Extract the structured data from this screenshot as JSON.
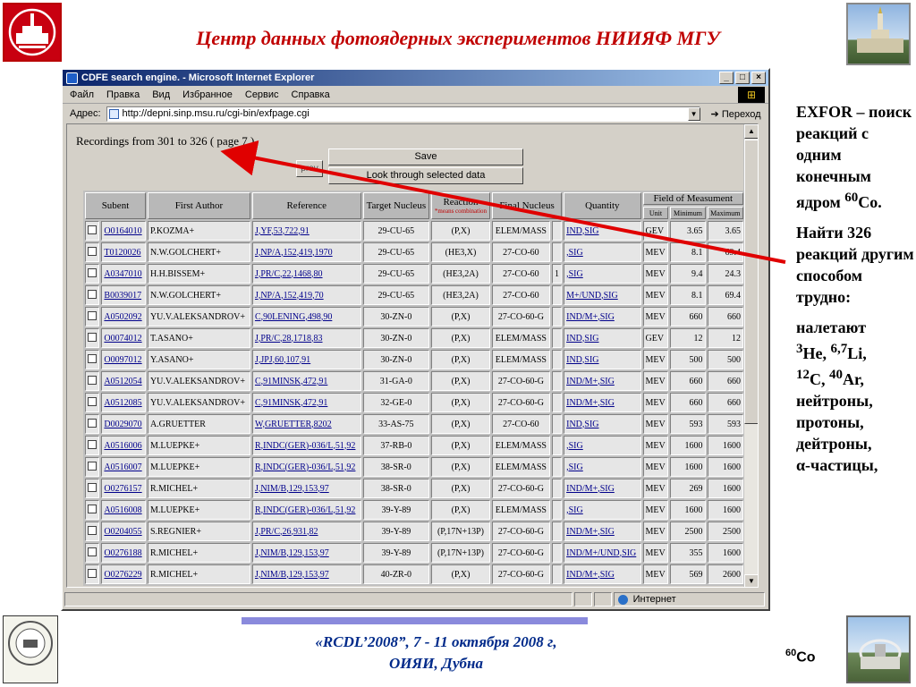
{
  "slide": {
    "title": "Центр данных фотоядерных экспериментов НИИЯФ МГУ",
    "side_exfor": "EXFOR – поиск реакций с одним конечным ядром",
    "side_co_mass": "60",
    "side_co_sym": "Co.",
    "side_find": "Найти 326 реакций другим способом трудно:",
    "side_incoming_label": "налетают",
    "side_he_mass": "3",
    "side_he": "He,",
    "side_li_mass": "6,7",
    "side_li": "Li,",
    "side_c_mass": "12",
    "side_c": "C,",
    "side_ar_mass": "40",
    "side_ar": "Ar,",
    "side_list": "нейтроны, протоны, дейтроны,",
    "side_alpha": "α-частицы,",
    "bottom_line1": "«RCDL’2008”,  7 - 11 октября 2008 г,",
    "bottom_line2": "ОИЯИ, Дубна",
    "corner_mass": "60",
    "corner_sym": "Co",
    "accent_red": "#c00000",
    "bottom_blue": "#002a8a"
  },
  "ie": {
    "window_title": "CDFE search engine. - Microsoft Internet Explorer",
    "menu": [
      "Файл",
      "Правка",
      "Вид",
      "Избранное",
      "Сервис",
      "Справка"
    ],
    "address_label": "Адрес:",
    "address_value": "http://depni.sinp.msu.ru/cgi-bin/exfpage.cgi",
    "go_label": "Переход",
    "status_zone": "Интернет"
  },
  "page": {
    "recordings": "Recordings from 301 to 326 ( page 7 )",
    "prev_label": "prev",
    "save_label": "Save",
    "look_label": "Look through selected data"
  },
  "table": {
    "headers": {
      "subent": "Subent",
      "first_author": "First Author",
      "reference": "Reference",
      "target_nucleus": "Target Nucleus",
      "reaction": "Reaction",
      "reaction_note": "*means combination",
      "final_nucleus": "Final Nucleus",
      "quantity": "Quantity",
      "field": "Field of Measument",
      "unit": "Unit",
      "minimum": "Minimum",
      "maximum": "Maximum"
    },
    "rows": [
      {
        "subent": "O0164010",
        "author": "P.KOZMA+",
        "ref": "J,YF,53,722,91",
        "target": "29-CU-65",
        "reaction": "(P,X)",
        "final": "ELEM/MASS",
        "flag": "",
        "quantity": "IND,SIG",
        "unit": "GEV",
        "min": "3.65",
        "max": "3.65"
      },
      {
        "subent": "T0120026",
        "author": "N.W.GOLCHERT+",
        "ref": "J,NP/A,152,419,1970",
        "target": "29-CU-65",
        "reaction": "(HE3,X)",
        "final": "27-CO-60",
        "flag": "",
        "quantity": ",SIG",
        "unit": "MEV",
        "min": "8.1",
        "max": "69.4"
      },
      {
        "subent": "A0347010",
        "author": "H.H.BISSEM+",
        "ref": "J,PR/C,22,1468,80",
        "target": "29-CU-65",
        "reaction": "(HE3,2A)",
        "final": "27-CO-60",
        "flag": "1",
        "quantity": ",SIG",
        "unit": "MEV",
        "min": "9.4",
        "max": "24.3"
      },
      {
        "subent": "B0039017",
        "author": "N.W.GOLCHERT+",
        "ref": "J,NP/A,152,419,70",
        "target": "29-CU-65",
        "reaction": "(HE3,2A)",
        "final": "27-CO-60",
        "flag": "",
        "quantity": "M+/UND,SIG",
        "unit": "MEV",
        "min": "8.1",
        "max": "69.4"
      },
      {
        "subent": "A0502092",
        "author": "YU.V.ALEKSANDROV+",
        "ref": "C,90LENING,498,90",
        "target": "30-ZN-0",
        "reaction": "(P,X)",
        "final": "27-CO-60-G",
        "flag": "",
        "quantity": "IND/M+,SIG",
        "unit": "MEV",
        "min": "660",
        "max": "660"
      },
      {
        "subent": "O0074012",
        "author": "T.ASANO+",
        "ref": "J,PR/C,28,1718,83",
        "target": "30-ZN-0",
        "reaction": "(P,X)",
        "final": "ELEM/MASS",
        "flag": "",
        "quantity": "IND,SIG",
        "unit": "GEV",
        "min": "12",
        "max": "12"
      },
      {
        "subent": "O0097012",
        "author": "Y.ASANO+",
        "ref": "J,JPJ,60,107,91",
        "target": "30-ZN-0",
        "reaction": "(P,X)",
        "final": "ELEM/MASS",
        "flag": "",
        "quantity": "IND,SIG",
        "unit": "MEV",
        "min": "500",
        "max": "500"
      },
      {
        "subent": "A0512054",
        "author": "YU.V.ALEKSANDROV+",
        "ref": "C,91MINSK,472,91",
        "target": "31-GA-0",
        "reaction": "(P,X)",
        "final": "27-CO-60-G",
        "flag": "",
        "quantity": "IND/M+,SIG",
        "unit": "MEV",
        "min": "660",
        "max": "660"
      },
      {
        "subent": "A0512085",
        "author": "YU.V.ALEKSANDROV+",
        "ref": "C,91MINSK,472,91",
        "target": "32-GE-0",
        "reaction": "(P,X)",
        "final": "27-CO-60-G",
        "flag": "",
        "quantity": "IND/M+,SIG",
        "unit": "MEV",
        "min": "660",
        "max": "660"
      },
      {
        "subent": "D0029070",
        "author": "A.GRUETTER",
        "ref": "W,GRUETTER,8202",
        "target": "33-AS-75",
        "reaction": "(P,X)",
        "final": "27-CO-60",
        "flag": "",
        "quantity": "IND,SIG",
        "unit": "MEV",
        "min": "593",
        "max": "593"
      },
      {
        "subent": "A0516006",
        "author": "M.LUEPKE+",
        "ref": "R,INDC(GER)-036/L,51,92",
        "target": "37-RB-0",
        "reaction": "(P,X)",
        "final": "ELEM/MASS",
        "flag": "",
        "quantity": ",SIG",
        "unit": "MEV",
        "min": "1600",
        "max": "1600"
      },
      {
        "subent": "A0516007",
        "author": "M.LUEPKE+",
        "ref": "R,INDC(GER)-036/L,51,92",
        "target": "38-SR-0",
        "reaction": "(P,X)",
        "final": "ELEM/MASS",
        "flag": "",
        "quantity": ",SIG",
        "unit": "MEV",
        "min": "1600",
        "max": "1600"
      },
      {
        "subent": "O0276157",
        "author": "R.MICHEL+",
        "ref": "J,NIM/B,129,153,97",
        "target": "38-SR-0",
        "reaction": "(P,X)",
        "final": "27-CO-60-G",
        "flag": "",
        "quantity": "IND/M+,SIG",
        "unit": "MEV",
        "min": "269",
        "max": "1600"
      },
      {
        "subent": "A0516008",
        "author": "M.LUEPKE+",
        "ref": "R,INDC(GER)-036/L,51,92",
        "target": "39-Y-89",
        "reaction": "(P,X)",
        "final": "ELEM/MASS",
        "flag": "",
        "quantity": ",SIG",
        "unit": "MEV",
        "min": "1600",
        "max": "1600"
      },
      {
        "subent": "O0204055",
        "author": "S.REGNIER+",
        "ref": "J,PR/C,26,931,82",
        "target": "39-Y-89",
        "reaction": "(P,17N+13P)",
        "final": "27-CO-60-G",
        "flag": "",
        "quantity": "IND/M+,SIG",
        "unit": "MEV",
        "min": "2500",
        "max": "2500"
      },
      {
        "subent": "O0276188",
        "author": "R.MICHEL+",
        "ref": "J,NIM/B,129,153,97",
        "target": "39-Y-89",
        "reaction": "(P,17N+13P)",
        "final": "27-CO-60-G",
        "flag": "",
        "quantity": "IND/M+/UND,SIG",
        "unit": "MEV",
        "min": "355",
        "max": "1600"
      },
      {
        "subent": "O0276229",
        "author": "R.MICHEL+",
        "ref": "J,NIM/B,129,153,97",
        "target": "40-ZR-0",
        "reaction": "(P,X)",
        "final": "27-CO-60-G",
        "flag": "",
        "quantity": "IND/M+,SIG",
        "unit": "MEV",
        "min": "569",
        "max": "2600"
      }
    ]
  }
}
